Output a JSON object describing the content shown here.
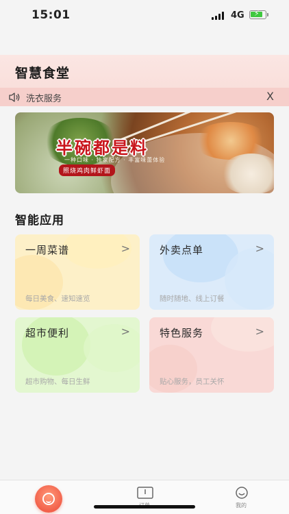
{
  "status_bar": {
    "time": "15:01",
    "network": "4G"
  },
  "header": {
    "title": "智慧食堂"
  },
  "notice": {
    "text": "洗衣服务",
    "close_label": "X"
  },
  "banner": {
    "headline": "半碗都是料",
    "subtitle": "一种口味 · 独家配方 · 丰富味蕾体验",
    "tag": "照烧鸡肉鲜虾面"
  },
  "section": {
    "title": "智能应用"
  },
  "apps": [
    {
      "title": "一周菜谱",
      "desc": "每日美食、速知速览",
      "arrow": ">"
    },
    {
      "title": "外卖点单",
      "desc": "随时随地、线上订餐",
      "arrow": ">"
    },
    {
      "title": "超市便利",
      "desc": "超市购物、每日生鲜",
      "arrow": ">"
    },
    {
      "title": "特色服务",
      "desc": "贴心服务，员工关怀",
      "arrow": ">"
    }
  ],
  "tabbar": {
    "orders_label": "订单",
    "mine_label": "我的",
    "accent": "#f2604a"
  }
}
